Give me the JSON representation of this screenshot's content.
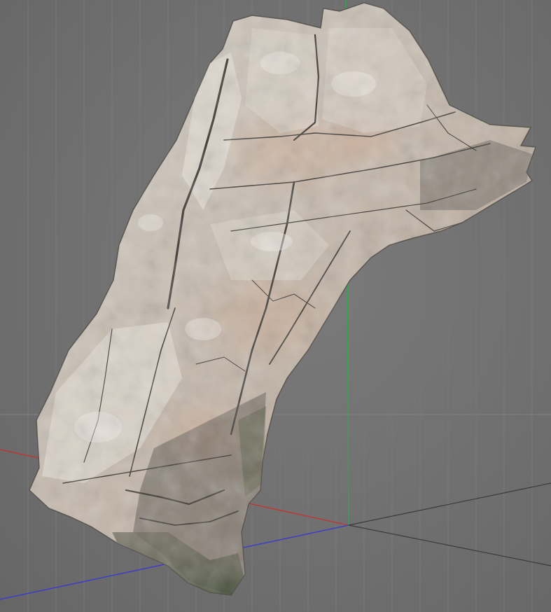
{
  "viewport": {
    "label": "",
    "background": "#707070"
  },
  "grid": {
    "major_line_color": "#7e7e7e",
    "minor_line_color": "#787878"
  },
  "axes": {
    "x_axis_color": "#c0352f",
    "y_axis_color": "#2fa84a",
    "z_axis_color": "#3a3ad0",
    "secondary_axis_color": "#3a3a3a"
  },
  "model": {
    "kind": "rock-scan-mesh",
    "base_color": "#cfc8bd",
    "shadow_color": "#7d746c",
    "warm_tint": "#c9a58c",
    "moss_color": "#4f5a3f"
  }
}
